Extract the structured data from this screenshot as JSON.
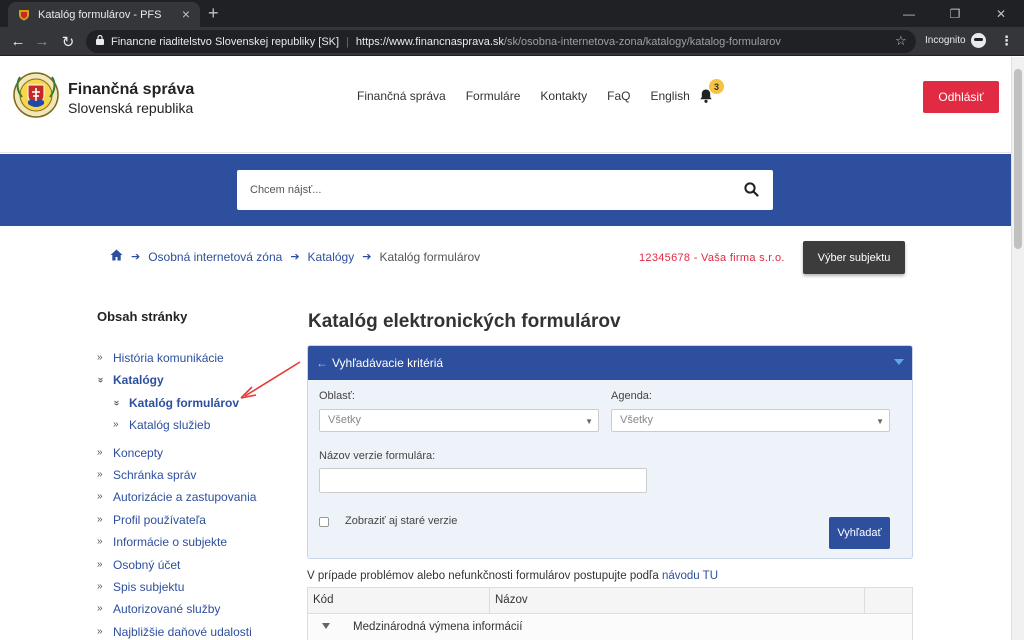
{
  "browser": {
    "tab_title": "Katalóg formulárov - PFS",
    "tab_close": "×",
    "new_tab": "+",
    "min": "—",
    "restore": "❐",
    "close": "✕",
    "back": "←",
    "forward": "→",
    "reload": "↻",
    "site_identity": "Financne riaditelstvo Slovenskej republiky [SK]",
    "url_host": "https://www.financnasprava.sk",
    "url_path": "/sk/osobna-internetova-zona/katalogy/katalog-formularov",
    "star": "☆",
    "incognito": "Incognito",
    "menu": "⋮"
  },
  "header": {
    "brand_line1": "Finančná správa",
    "brand_line2": "Slovenská republika",
    "nav": [
      "Finančná správa",
      "Formuláre",
      "Kontakty",
      "FaQ",
      "English"
    ],
    "notification_count": "3",
    "logout": "Odhlásiť"
  },
  "search": {
    "placeholder": "Chcem nájsť..."
  },
  "breadcrumb": {
    "items": [
      "Osobná internetová zóna",
      "Katalógy",
      "Katalóg formulárov"
    ],
    "arrow": "➔"
  },
  "subject": {
    "firm": "12345678 - Vaša firma s.r.o.",
    "select_button": "Výber subjektu"
  },
  "sidebar": {
    "title": "Obsah stránky",
    "items": [
      {
        "label": "História komunikácie",
        "chev": "»"
      },
      {
        "label": "Katalógy",
        "chev": "»"
      },
      {
        "label": "Katalóg formulárov",
        "chev": "»"
      },
      {
        "label": "Katalóg služieb",
        "chev": "»"
      },
      {
        "label": "Koncepty",
        "chev": "»"
      },
      {
        "label": "Schránka správ",
        "chev": "»"
      },
      {
        "label": "Autorizácie a zastupovania",
        "chev": "»"
      },
      {
        "label": "Profil používateľa",
        "chev": "»"
      },
      {
        "label": "Informácie o subjekte",
        "chev": "»"
      },
      {
        "label": "Osobný účet",
        "chev": "»"
      },
      {
        "label": "Spis subjektu",
        "chev": "»"
      },
      {
        "label": "Autorizované služby",
        "chev": "»"
      },
      {
        "label": "Najbližšie daňové udalosti",
        "chev": "»"
      }
    ]
  },
  "main": {
    "title": "Katalóg elektronických formulárov",
    "panel_title": "Vyhľadávacie kritériá",
    "panel_prefix": "←",
    "area_label": "Oblasť:",
    "area_value": "Všetky",
    "agenda_label": "Agenda:",
    "agenda_value": "Všetky",
    "name_label": "Názov verzie formulára:",
    "show_old": "Zobraziť aj staré verzie",
    "search_button": "Vyhľadať",
    "caret": "▼",
    "note_text": "V prípade problémov alebo nefunkčnosti formulárov postupujte podľa ",
    "note_link": "návodu TU",
    "table_headers": [
      "Kód",
      "Názov"
    ],
    "group_row": "Medzinárodná výmena informácií"
  },
  "colors": {
    "brand_blue": "#2d4f9e",
    "logout_red": "#e12b43",
    "badge_yellow": "#f6c242"
  }
}
